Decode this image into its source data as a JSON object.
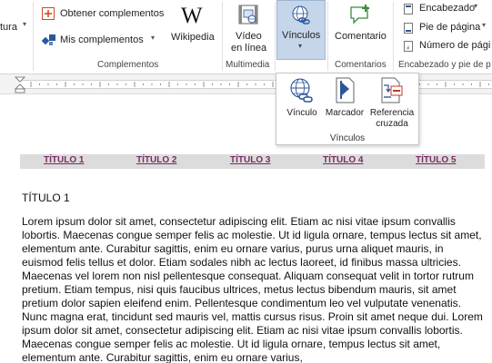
{
  "ribbon": {
    "left_cut_label": "tura",
    "complementos": {
      "obtener": "Obtener complementos",
      "mis": "Mis complementos",
      "wikipedia": "Wikipedia",
      "group_label": "Complementos"
    },
    "multimedia": {
      "video_line1": "Vídeo",
      "video_line2": "en línea",
      "group_label": "Multimedia"
    },
    "vinculos_button": "Vínculos",
    "comentarios": {
      "comentario": "Comentario",
      "group_label": "Comentarios"
    },
    "encabezado": {
      "encabezado": "Encabezado",
      "pie": "Pie de página",
      "numero": "Número de pági",
      "group_label": "Encabezado y pie de p"
    }
  },
  "vinculos_panel": {
    "items": [
      {
        "label": "Vínculo"
      },
      {
        "label": "Marcador"
      },
      {
        "label_line1": "Referencia",
        "label_line2": "cruzada"
      }
    ],
    "group_label": "Vínculos"
  },
  "document": {
    "nav_links": [
      "TÍTULO 1",
      "TÍTULO 2",
      "TÍTULO 3",
      "TÍTULO 4",
      "TÍTULO 5"
    ],
    "heading": "TÍTULO 1",
    "body": "Lorem ipsum dolor sit amet, consectetur adipiscing elit. Etiam ac nisi vitae ipsum convallis lobortis. Maecenas congue semper felis ac molestie. Ut id ligula ornare, tempus lectus sit amet, elementum ante. Curabitur sagittis, enim eu ornare varius, purus urna aliquet mauris, in euismod felis tellus et dolor. Etiam sodales nibh ac lectus laoreet, id finibus massa ultricies. Maecenas vel lorem non nisl pellentesque consequat. Aliquam consequat velit in tortor rutrum pretium. Etiam tempus, nisi quis faucibus ultrices, metus lectus bibendum mauris, sit amet pretium dolor sapien eleifend enim. Pellentesque condimentum leo vel vulputate venenatis. Nunc magna erat, tincidunt sed mauris vel, mattis cursus risus. Proin sit amet neque dui. Lorem ipsum dolor sit amet, consectetur adipiscing elit. Etiam ac nisi vitae ipsum convallis lobortis. Maecenas congue semper felis ac molestie. Ut id ligula ornare, tempus lectus sit amet, elementum ante. Curabitur sagittis, enim eu ornare varius,"
  },
  "colors": {
    "accent": "#c5d5ea",
    "link": "#7b2c63",
    "nav_bg": "#dcdcdc"
  }
}
